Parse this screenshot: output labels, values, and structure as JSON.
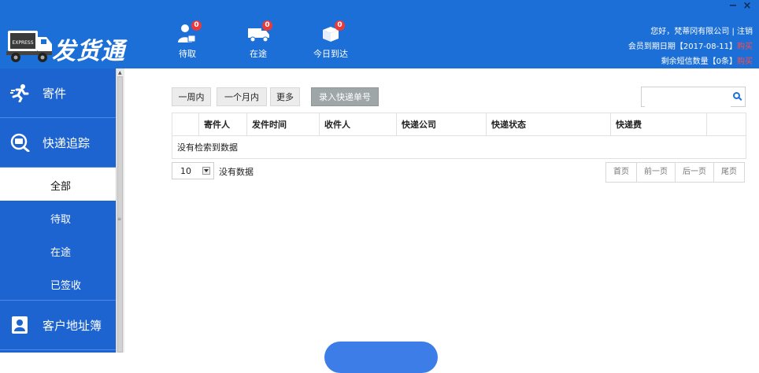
{
  "window": {
    "minimize": "−",
    "close": "×"
  },
  "app": {
    "name": "发货通",
    "truck_label": "EXPRESS"
  },
  "nav": [
    {
      "label": "待取",
      "badge": "0",
      "icon": "courier-person-icon"
    },
    {
      "label": "在途",
      "badge": "0",
      "icon": "delivery-truck-icon"
    },
    {
      "label": "今日到达",
      "badge": "0",
      "icon": "package-arrived-icon"
    }
  ],
  "user": {
    "greeting": "您好，梵蒂冈有限公司 | 注销",
    "member_prefix": "会员到期日期【2017-08-11】",
    "member_link": "购买",
    "sms_prefix": "剩余短信数量【0条】",
    "sms_link": "购买"
  },
  "sidebar": {
    "send": "寄件",
    "track": "快递追踪",
    "sub": [
      "全部",
      "待取",
      "在途",
      "已签收"
    ],
    "address": "客户地址簿"
  },
  "filters": {
    "week": "一周内",
    "month": "一个月内",
    "more": "更多",
    "enter": "录入快递单号"
  },
  "search": {
    "placeholder": ""
  },
  "table": {
    "headers": [
      "",
      "寄件人",
      "发件时间",
      "收件人",
      "快递公司",
      "快递状态",
      "快递费",
      ""
    ],
    "empty": "没有检索到数据"
  },
  "pager": {
    "size": "10",
    "status": "没有数据",
    "first": "首页",
    "prev": "前一页",
    "next": "后一页",
    "last": "尾页"
  },
  "colors": {
    "header": "#1c6fd6",
    "sidebar": "#1d64d0",
    "badge": "#e83a3a"
  }
}
